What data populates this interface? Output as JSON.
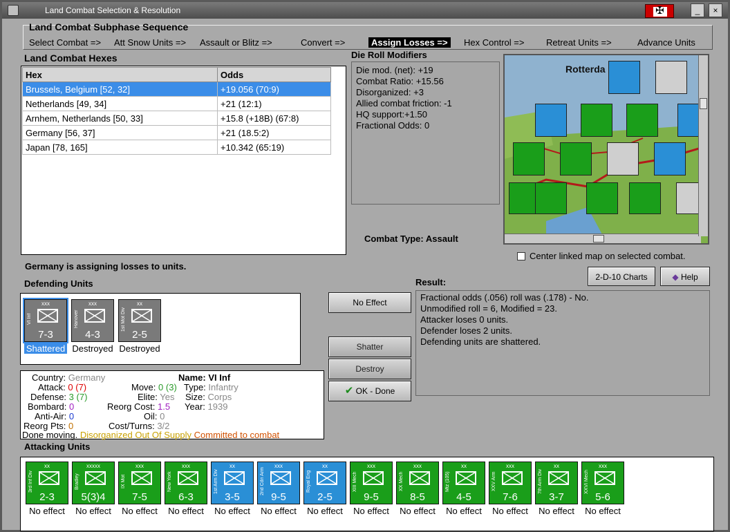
{
  "window": {
    "title": "Land Combat Selection & Resolution"
  },
  "subphase": {
    "title": "Land Combat Subphase Sequence",
    "steps": [
      "Select Combat =>",
      "Att Snow Units =>",
      "Assault or Blitz =>",
      "Convert =>",
      "Assign Losses =>",
      "Hex Control =>",
      "Retreat Units =>",
      "Advance Units"
    ],
    "active_step": "Assign Losses =>"
  },
  "hexes": {
    "title": "Land Combat Hexes",
    "columns": [
      "Hex",
      "Odds"
    ],
    "rows": [
      {
        "hex": "Brussels, Belgium [52, 32]",
        "odds": "+19.056 (70:9)",
        "selected": true
      },
      {
        "hex": "Netherlands [49, 34]",
        "odds": "+21 (12:1)"
      },
      {
        "hex": "Arnhem, Netherlands [50, 33]",
        "odds": "+15.8 (+18B) (67:8)"
      },
      {
        "hex": "Germany [56, 37]",
        "odds": "+21 (18.5:2)"
      },
      {
        "hex": "Japan [78, 165]",
        "odds": "+10.342 (65:19)"
      }
    ]
  },
  "modifiers": {
    "title": "Die Roll Modifiers",
    "lines": [
      "Die mod. (net): +19",
      "",
      "Combat Ratio: +15.56",
      "Disorganized: +3",
      "Allied combat friction: -1",
      "HQ support:+1.50",
      "Fractional Odds: 0"
    ]
  },
  "combat_type": {
    "label": "Combat Type:",
    "value": "Assault"
  },
  "map": {
    "city_label": "Rotterda",
    "center_checkbox_label": "Center linked map on selected combat."
  },
  "status_message": "Germany is assigning losses to units.",
  "defending": {
    "title": "Defending Units",
    "units": [
      {
        "name": "VI Inf",
        "size": "xxx",
        "strength": "7-3",
        "status": "Shattered",
        "color": "#7a7a7a",
        "selected": true
      },
      {
        "name": "Hanover",
        "size": "xxx",
        "strength": "4-3",
        "status": "Destroyed",
        "color": "#7a7a7a"
      },
      {
        "name": "1st Mot Div",
        "size": "xx",
        "strength": "2-5",
        "status": "Destroyed",
        "color": "#7a7a7a"
      }
    ]
  },
  "buttons": {
    "no_effect": "No Effect",
    "shatter": "Shatter",
    "destroy": "Destroy",
    "ok_done": "OK - Done",
    "charts": "2-D-10 Charts",
    "help": "Help"
  },
  "result": {
    "title": "Result:",
    "lines": [
      "Fractional odds (.056) roll was (.178)  - No.",
      "Unmodified roll = 6, Modified = 23.",
      "Attacker loses 0 units.",
      "Defender loses 2 units.",
      "Defending units are shattered."
    ]
  },
  "unit_info": {
    "country_label": "Country:",
    "country": "Germany",
    "attack_label": "Attack:",
    "attack": "0",
    "attack_paren": "(7)",
    "defense_label": "Defense:",
    "defense": "3",
    "defense_paren": "(7)",
    "bombard_label": "Bombard:",
    "bombard": "0",
    "antiair_label": "Anti-Air:",
    "antiair": "0",
    "reorg_pts_label": "Reorg Pts:",
    "reorg_pts": "0",
    "name_label": "Name:",
    "name": "VI Inf",
    "move_label": "Move:",
    "move": "0",
    "move_paren": "(3)",
    "elite_label": "Elite:",
    "elite": "Yes",
    "reorg_cost_label": "Reorg Cost:",
    "reorg_cost": "1.5",
    "oil_label": "Oil:",
    "oil": "0",
    "cost_turns_label": "Cost/Turns:",
    "cost_turns": "3/2",
    "type_label": "Type:",
    "type": "Infantry",
    "size_label": "Size:",
    "size": "Corps",
    "year_label": "Year:",
    "year": "1939",
    "status_prefix": "Done moving.",
    "status_disorg": "Disorganized",
    "status_supply": "Out Of Supply",
    "status_committed": "Committed to combat"
  },
  "attacking": {
    "title": "Attacking Units",
    "units": [
      {
        "name": "3rd Inf Div",
        "size": "xx",
        "strength": "2-3",
        "status": "No effect",
        "color": "#1a9e1a"
      },
      {
        "name": "Bradley",
        "size": "xxxxx",
        "strength": "5(3)4",
        "status": "No effect",
        "color": "#1a9e1a"
      },
      {
        "name": "IX Mot",
        "size": "xxx",
        "strength": "7-5",
        "status": "No effect",
        "color": "#1a9e1a"
      },
      {
        "name": "New York",
        "size": "xxx",
        "strength": "6-3",
        "status": "No effect",
        "color": "#1a9e1a"
      },
      {
        "name": "1st Arm Div",
        "size": "xx",
        "strength": "3-5",
        "status": "No effect",
        "color": "#2a8fd6"
      },
      {
        "name": "2nd Cdn Arm",
        "size": "xxx",
        "strength": "9-5",
        "status": "No effect",
        "color": "#2a8fd6"
      },
      {
        "name": "Royal Eng",
        "size": "xx",
        "strength": "2-5",
        "status": "No effect",
        "color": "#2a8fd6"
      },
      {
        "name": "XIII Mech",
        "size": "xxx",
        "strength": "9-5",
        "status": "No effect",
        "color": "#1a9e1a"
      },
      {
        "name": "XX Mech",
        "size": "xxx",
        "strength": "8-5",
        "status": "No effect",
        "color": "#1a9e1a"
      },
      {
        "name": "Mtz (105)",
        "size": "xx",
        "strength": "4-5",
        "status": "No effect",
        "color": "#1a9e1a"
      },
      {
        "name": "XXV Arm",
        "size": "xxx",
        "strength": "7-6",
        "status": "No effect",
        "color": "#1a9e1a"
      },
      {
        "name": "7th Arm Div",
        "size": "xx",
        "strength": "3-7",
        "status": "No effect",
        "color": "#1a9e1a"
      },
      {
        "name": "XXVI Mech",
        "size": "xxx",
        "strength": "5-6",
        "status": "No effect",
        "color": "#1a9e1a"
      }
    ]
  },
  "colors": {
    "selection": "#3b8de8",
    "us_green": "#1a9e1a",
    "uk_blue": "#2a8fd6",
    "german_gray": "#7a7a7a"
  }
}
